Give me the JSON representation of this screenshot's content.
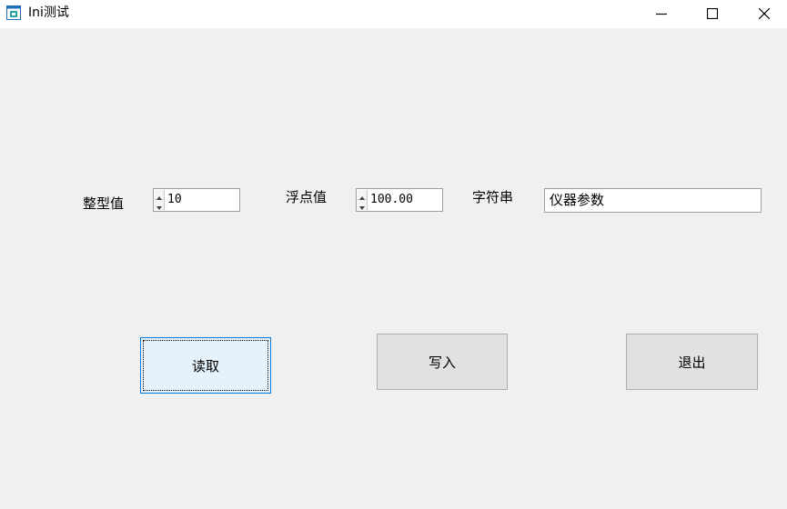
{
  "window": {
    "title": "Ini测试"
  },
  "form": {
    "int_label": "整型值",
    "int_value": "10",
    "float_label": "浮点值",
    "float_value": "100.00",
    "string_label": "字符串",
    "string_value": "仪器参数"
  },
  "buttons": {
    "read": "读取",
    "write": "写入",
    "exit": "退出"
  },
  "colors": {
    "focus_border": "#0078d7",
    "focus_bg": "#e5f1fb",
    "button_bg": "#e1e1e1"
  }
}
